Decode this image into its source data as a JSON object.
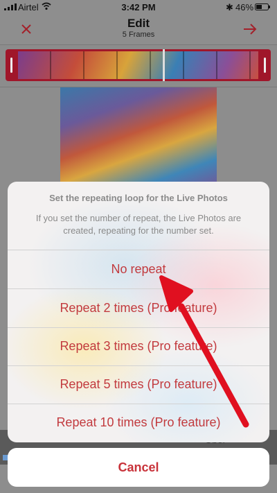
{
  "status_bar": {
    "carrier": "Airtel",
    "time": "3:42 PM",
    "battery": "46%"
  },
  "nav": {
    "title": "Edit",
    "subtitle": "5 Frames"
  },
  "sheet": {
    "title": "Set the repeating loop for the Live Photos",
    "message": "If you set the number of repeat, the Live Photos are created, repeating for the number set.",
    "options": [
      "No repeat",
      "Repeat 2 times (Pro feature)",
      "Repeat 3 times (Pro feature)",
      "Repeat 5 times (Pro feature)",
      "Repeat 10 times (Pro feature)"
    ],
    "cancel": "Cancel"
  },
  "ad": {
    "text": "Uber"
  },
  "colors": {
    "accent": "#c8323a",
    "annotation": "#e01020"
  }
}
